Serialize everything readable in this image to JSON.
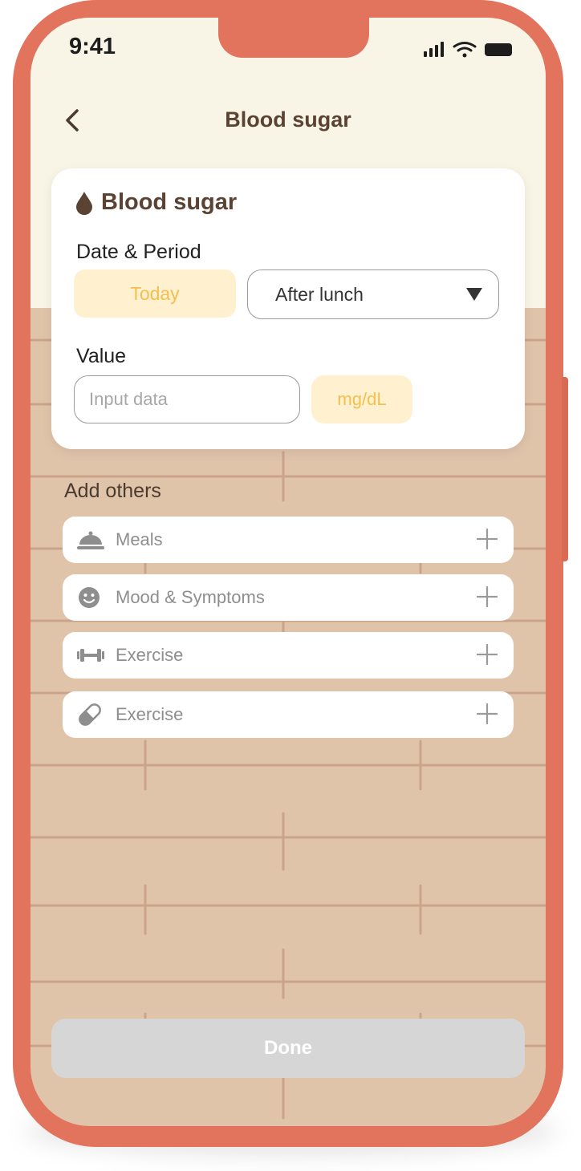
{
  "status_bar": {
    "time": "9:41"
  },
  "header": {
    "title": "Blood sugar"
  },
  "card": {
    "title": "Blood sugar",
    "date_period_label": "Date & Period",
    "date_button": "Today",
    "period_selected": "After lunch",
    "value_label": "Value",
    "value_placeholder": "Input data",
    "unit_button": "mg/dL"
  },
  "others": {
    "title": "Add others",
    "items": [
      {
        "label": "Meals",
        "icon": "meal-cloche-icon"
      },
      {
        "label": "Mood & Symptoms",
        "icon": "smiley-icon"
      },
      {
        "label": "Exercise",
        "icon": "dumbbell-icon"
      },
      {
        "label": "Exercise",
        "icon": "pill-icon"
      }
    ]
  },
  "footer": {
    "done_label": "Done"
  },
  "colors": {
    "frame": "#e2735d",
    "header_bg": "#f9f5e6",
    "wall": "#e0c4aa",
    "accent_text": "#f3c04f",
    "accent_bg": "#fff0d0",
    "title_brown": "#5b4334",
    "disabled_button": "#d6d6d6"
  }
}
